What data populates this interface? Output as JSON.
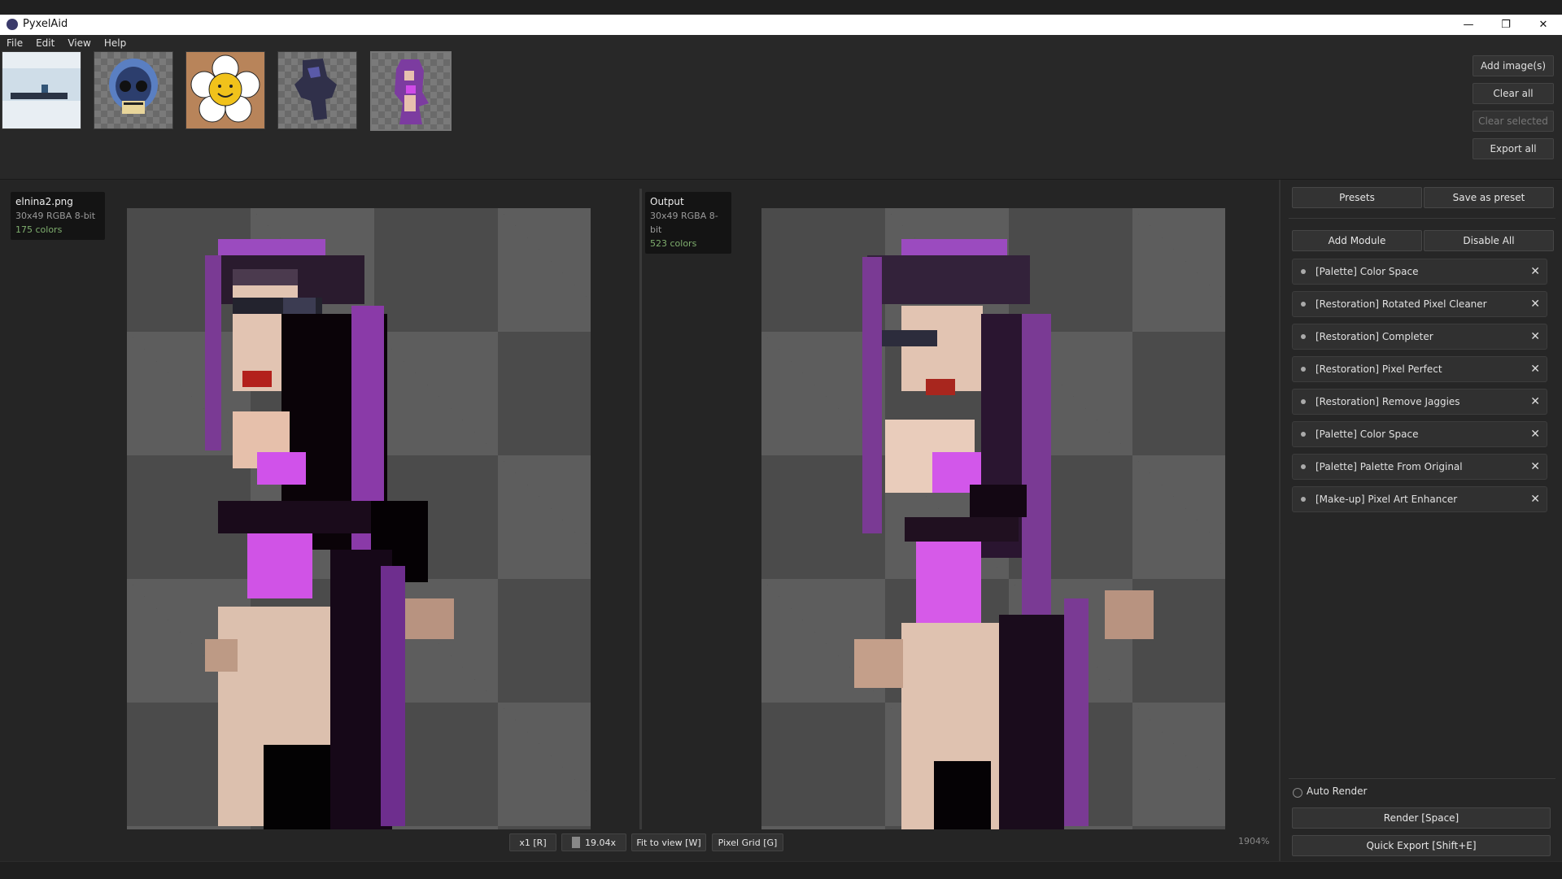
{
  "window": {
    "title": "PyxelAid",
    "controls": [
      "—",
      "❐",
      "✕"
    ]
  },
  "menu": [
    "File",
    "Edit",
    "View",
    "Help"
  ],
  "thumbnails": [
    {
      "name": "snow-scene"
    },
    {
      "name": "blue-skull"
    },
    {
      "name": "flower-smiley"
    },
    {
      "name": "dark-warrior"
    },
    {
      "name": "purple-girl"
    }
  ],
  "top_buttons": {
    "add": "Add image(s)",
    "clear_all": "Clear all",
    "clear_selected": "Clear selected",
    "export_all": "Export all"
  },
  "input_info": {
    "filename": "elnina2.png",
    "meta": "30x49  RGBA  8-bit",
    "colors": "175 colors"
  },
  "output_info": {
    "filename": "Output",
    "meta": "30x49  RGBA  8-bit",
    "colors": "523 colors"
  },
  "bottom_controls": {
    "scale": "x1 [R]",
    "zoom": "19.04x",
    "fit": "Fit to view [W]",
    "grid": "Pixel Grid [G]",
    "zoom_percent": "1904%"
  },
  "panel": {
    "presets": "Presets",
    "save_preset": "Save as preset",
    "add_module": "Add Module",
    "disable_all": "Disable All",
    "modules": [
      "[Palette] Color Space",
      "[Restoration] Rotated Pixel Cleaner",
      "[Restoration] Completer",
      "[Restoration] Pixel Perfect",
      "[Restoration] Remove Jaggies",
      "[Palette] Color Space",
      "[Palette] Palette From Original",
      "[Make-up] Pixel Art Enhancer"
    ],
    "close_glyph": "✕",
    "auto_render": "Auto Render",
    "render": "Render  [Space]",
    "quick_export": "Quick Export  [Shift+E]"
  }
}
